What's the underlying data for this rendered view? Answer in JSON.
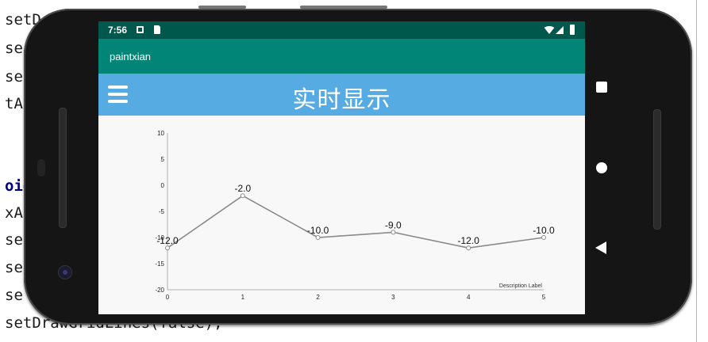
{
  "background_code": [
    {
      "text": "setD",
      "kw": false
    },
    {
      "text": "se",
      "kw": false
    },
    {
      "text": "se",
      "kw": false
    },
    {
      "text": "tAx",
      "kw": false
    },
    {
      "text": "oid",
      "kw": true
    },
    {
      "text": "xA",
      "kw": false
    },
    {
      "text": "se",
      "kw": false
    },
    {
      "text": "se",
      "kw": false
    },
    {
      "text": "se",
      "kw": false
    },
    {
      "text": "setDrawGridLines(false);",
      "kw": false
    }
  ],
  "status_bar": {
    "time": "7:56"
  },
  "app_bar": {
    "title": "paintxian"
  },
  "header": {
    "title": "实时显示"
  },
  "chart_data": {
    "type": "line",
    "x": [
      0,
      1,
      2,
      3,
      4,
      5
    ],
    "values": [
      -12.0,
      -2.0,
      -10.0,
      -9.0,
      -12.0,
      -10.0
    ],
    "value_labels": [
      "-12.0",
      "-2.0",
      "-10.0",
      "-9.0",
      "-12.0",
      "-10.0"
    ],
    "x_ticks": [
      "0",
      "1",
      "2",
      "3",
      "4",
      "5"
    ],
    "y_ticks": [
      "10",
      "5",
      "0",
      "-5",
      "-10",
      "-15",
      "-20"
    ],
    "ylim": [
      -20,
      10
    ],
    "xlim": [
      0,
      5
    ],
    "description": "Description Label",
    "line_color": "#8a8a8a",
    "grid": false
  }
}
